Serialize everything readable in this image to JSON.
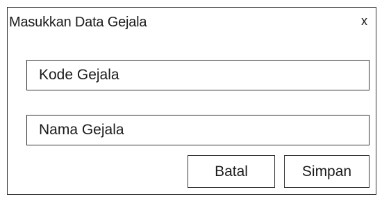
{
  "dialog": {
    "title": "Masukkan Data Gejala",
    "close_label": "x"
  },
  "form": {
    "kode_gejala": {
      "placeholder": "Kode Gejala",
      "value": ""
    },
    "nama_gejala": {
      "placeholder": "Nama Gejala",
      "value": ""
    }
  },
  "buttons": {
    "cancel_label": "Batal",
    "save_label": "Simpan"
  }
}
